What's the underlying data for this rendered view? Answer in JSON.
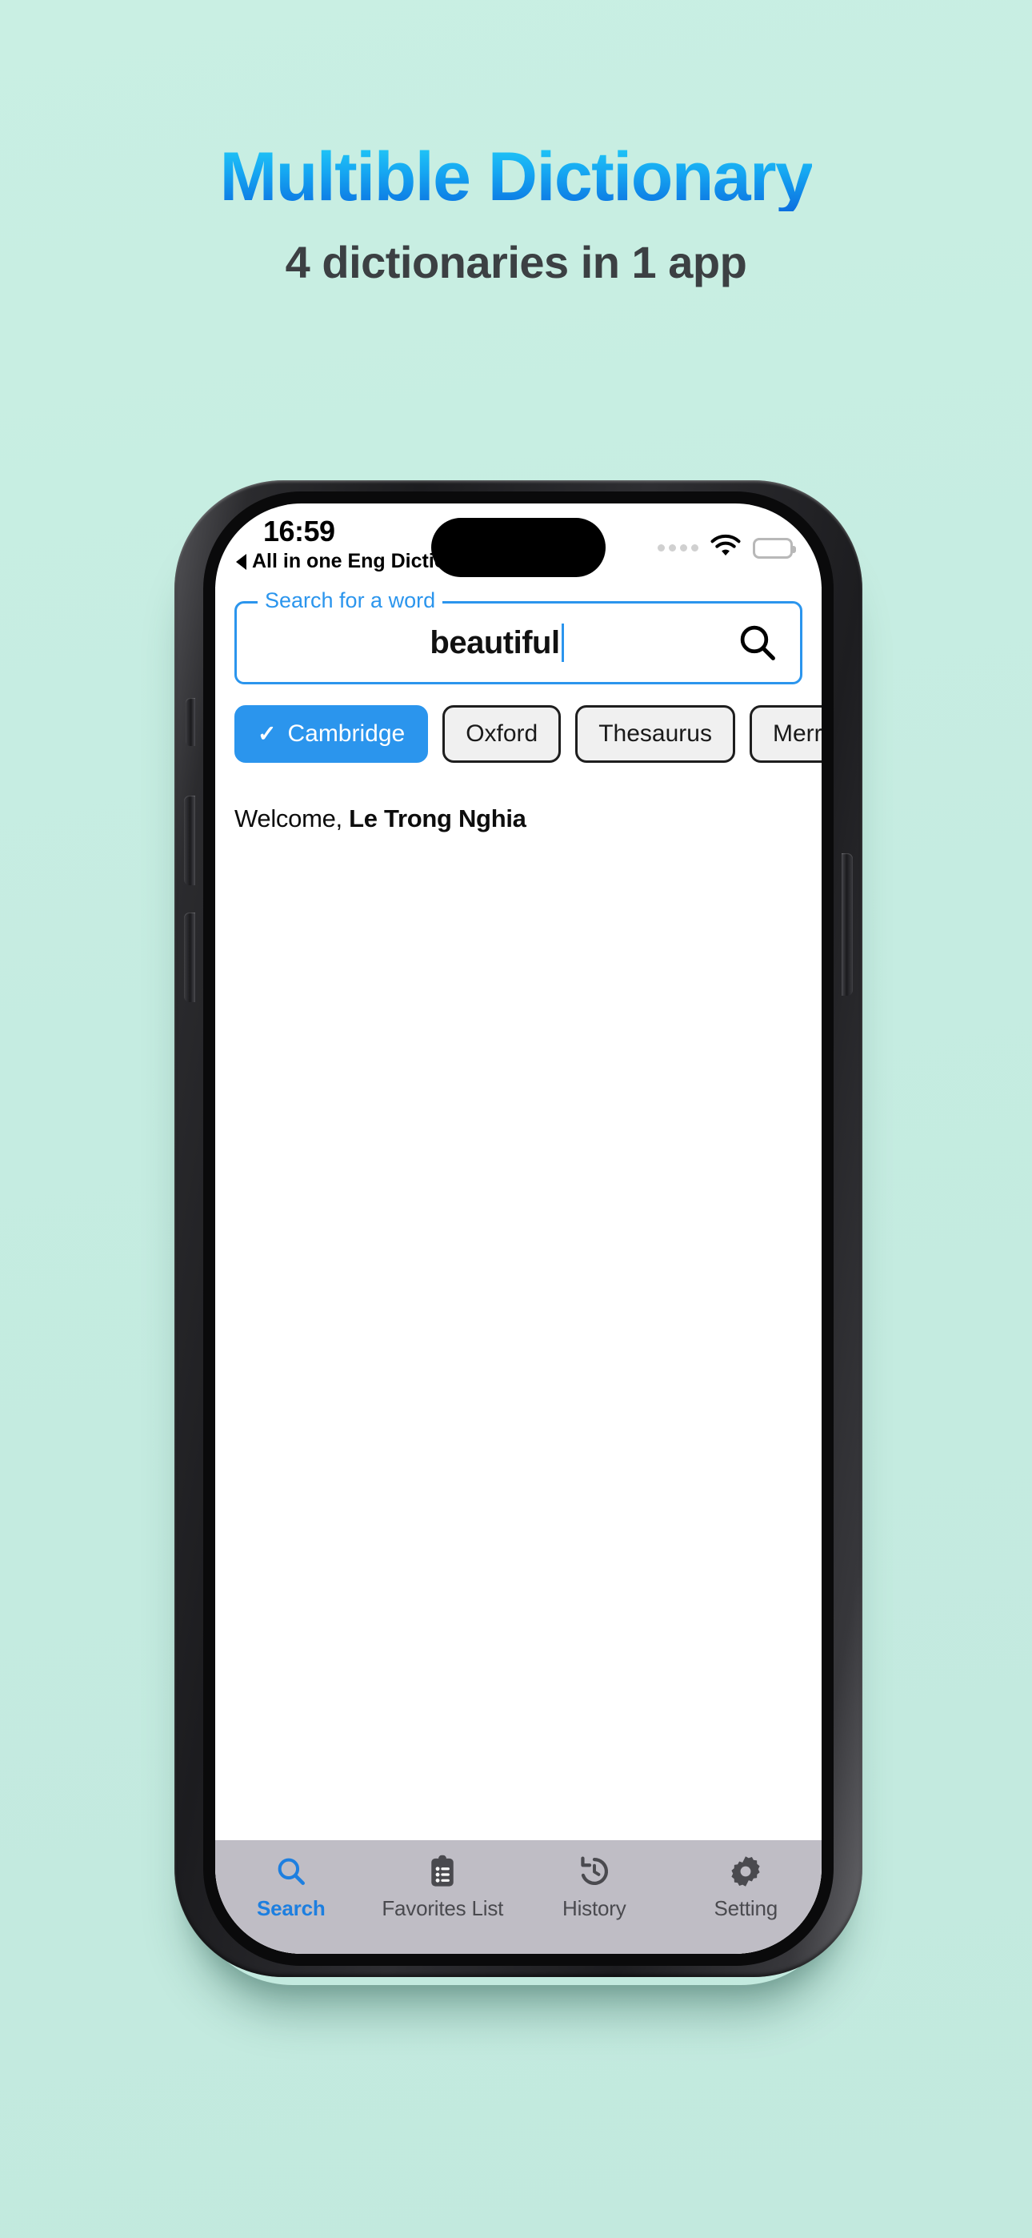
{
  "promo": {
    "title": "Multible Dictionary",
    "subtitle": "4 dictionaries in 1 app",
    "background_color": "#c5ece1",
    "title_gradient_from": "#22cbf7",
    "title_gradient_to": "#0b6fe0",
    "subtitle_color": "#3c4043"
  },
  "status_bar": {
    "time": "16:59",
    "back_label": "All in one Eng Dictio...",
    "back_arrow_icon": "triangle-left-icon",
    "signal_icon": "signal-dots-icon",
    "wifi_icon": "wifi-icon",
    "battery_icon": "battery-full-icon"
  },
  "search": {
    "label": "Search for a word",
    "value": "beautiful",
    "placeholder": "Search for a word",
    "icon": "search-icon",
    "border_color": "#2b95ed"
  },
  "dictionaries": [
    {
      "label": "Cambridge",
      "selected": true,
      "check_icon": "check-icon"
    },
    {
      "label": "Oxford",
      "selected": false,
      "check_icon": ""
    },
    {
      "label": "Thesaurus",
      "selected": false,
      "check_icon": ""
    },
    {
      "label": "Merriam",
      "selected": false,
      "check_icon": ""
    }
  ],
  "welcome": {
    "greeting": "Welcome, ",
    "user_name": "Le Trong Nghia"
  },
  "tabs": [
    {
      "label": "Search",
      "icon": "search-icon",
      "active": true
    },
    {
      "label": "Favorites List",
      "icon": "clipboard-list-icon",
      "active": false
    },
    {
      "label": "History",
      "icon": "history-clock-icon",
      "active": false
    },
    {
      "label": "Setting",
      "icon": "gear-icon",
      "active": false
    }
  ],
  "accent_color": "#2b95ed",
  "tabbar_color": "#bfbdc5"
}
